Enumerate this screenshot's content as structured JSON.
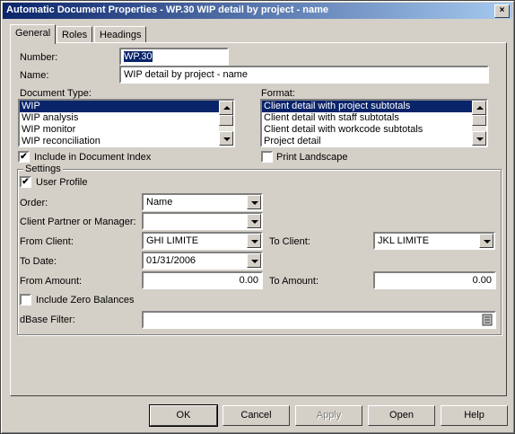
{
  "window": {
    "title": "Automatic Document Properties - WP.30 WIP detail by project - name",
    "close": "×"
  },
  "tabs": [
    "General",
    "Roles",
    "Headings"
  ],
  "general": {
    "number_label": "Number:",
    "number_value": "WP.30",
    "name_label": "Name:",
    "name_value": "WIP detail by project - name",
    "doc_type_label": "Document Type:",
    "doc_types": [
      "WIP",
      "WIP analysis",
      "WIP monitor",
      "WIP reconciliation"
    ],
    "format_label": "Format:",
    "formats": [
      "Client detail with project subtotals",
      "Client detail with staff subtotals",
      "Client detail with workcode subtotals",
      "Project detail"
    ],
    "include_index_label": "Include in Document Index",
    "include_index_checked": true,
    "print_landscape_label": "Print Landscape",
    "print_landscape_checked": false
  },
  "settings": {
    "group_label": "Settings",
    "user_profile_label": "User Profile",
    "user_profile_checked": true,
    "order_label": "Order:",
    "order_value": "Name",
    "partner_label": "Client Partner or Manager:",
    "partner_value": "",
    "from_client_label": "From Client:",
    "from_client_value": "GHI LIMITE",
    "to_client_label": "To Client:",
    "to_client_value": "JKL LIMITE",
    "to_date_label": "To Date:",
    "to_date_value": "01/31/2006",
    "from_amount_label": "From Amount:",
    "from_amount_value": "0.00",
    "to_amount_label": "To Amount:",
    "to_amount_value": "0.00",
    "zero_balances_label": "Include Zero Balances",
    "zero_balances_checked": false,
    "dbase_filter_label": "dBase Filter:",
    "dbase_filter_value": ""
  },
  "buttons": {
    "ok": "OK",
    "cancel": "Cancel",
    "apply": "Apply",
    "open": "Open",
    "help": "Help"
  },
  "check_mark": "✔"
}
